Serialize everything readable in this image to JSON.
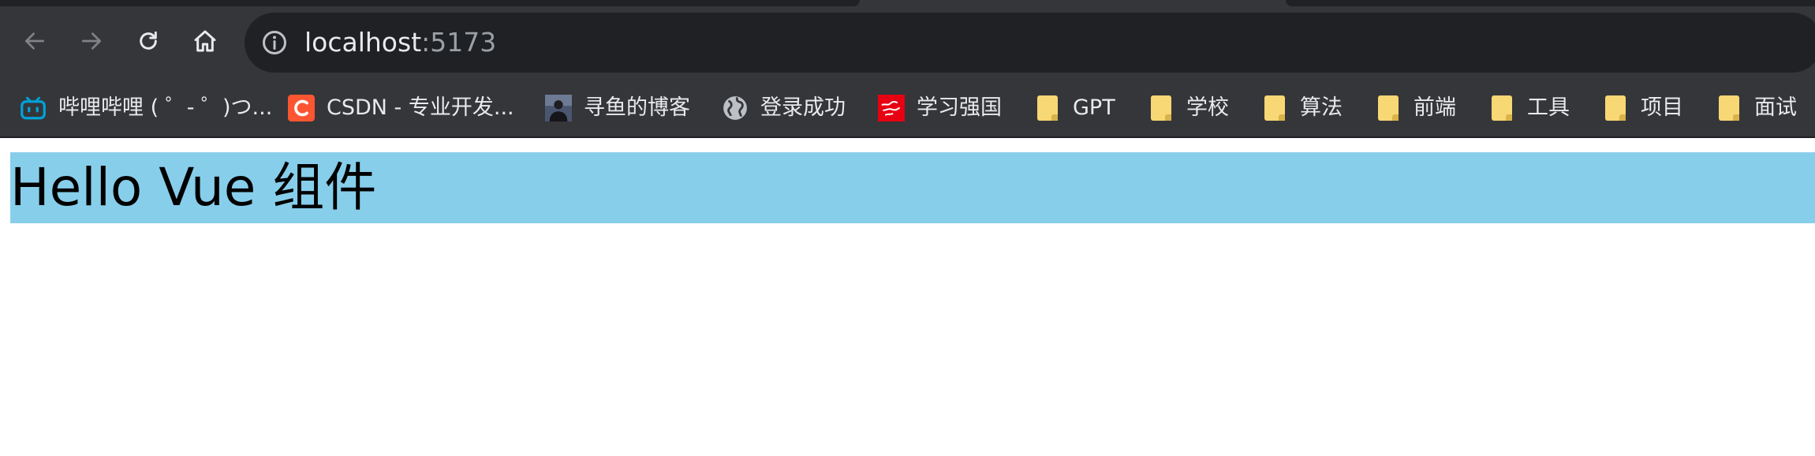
{
  "browser": {
    "address_bar": {
      "host": "localhost",
      "port": ":5173"
    },
    "bookmarks": [
      {
        "label": "哔哩哔哩 ( ゜- ゜)つ...",
        "icon": "bilibili-icon"
      },
      {
        "label": "CSDN - 专业开发...",
        "icon": "csdn-icon"
      },
      {
        "label": "寻鱼的博客",
        "icon": "avatar-icon"
      },
      {
        "label": "登录成功",
        "icon": "globe-icon"
      },
      {
        "label": "学习强国",
        "icon": "xuexi-icon"
      },
      {
        "label": "GPT",
        "icon": "folder-icon"
      },
      {
        "label": "学校",
        "icon": "folder-icon"
      },
      {
        "label": "算法",
        "icon": "folder-icon"
      },
      {
        "label": "前端",
        "icon": "folder-icon"
      },
      {
        "label": "工具",
        "icon": "folder-icon"
      },
      {
        "label": "项目",
        "icon": "folder-icon"
      },
      {
        "label": "面试",
        "icon": "folder-icon"
      }
    ]
  },
  "page": {
    "heading": "Hello Vue 组件",
    "heading_background": "#87ceeb"
  },
  "colors": {
    "chrome_toolbar": "#35363a",
    "omnibox": "#202124",
    "text_light": "#e8eaed",
    "text_dim": "#9aa0a6",
    "folder": "#f8d775",
    "csdn": "#fc5531",
    "bilibili": "#00a1d6",
    "xuexi": "#e60012"
  }
}
